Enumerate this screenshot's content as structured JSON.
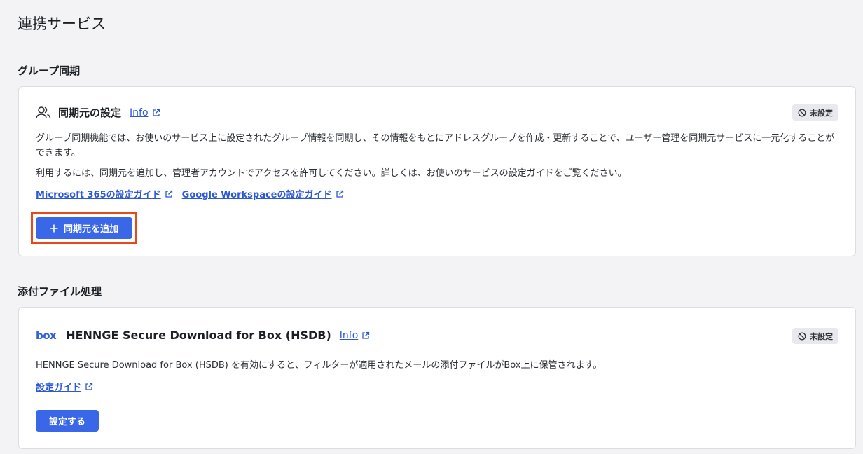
{
  "page": {
    "title": "連携サービス"
  },
  "group_sync": {
    "section_title": "グループ同期",
    "card_title": "同期元の設定",
    "info_label": "Info",
    "status_badge": "未設定",
    "description_1": "グループ同期機能では、お使いのサービス上に設定されたグループ情報を同期し、その情報をもとにアドレスグループを作成・更新することで、ユーザー管理を同期元サービスに一元化することができます。",
    "description_2": "利用するには、同期元を追加し、管理者アカウントでアクセスを許可してください。詳しくは、お使いのサービスの設定ガイドをご覧ください。",
    "guide_links": [
      "Microsoft 365の設定ガイド",
      "Google Workspaceの設定ガイド"
    ],
    "add_button": "同期元を追加"
  },
  "attachment": {
    "section_title": "添付ファイル処理",
    "box_logo": "box",
    "card_title": "HENNGE Secure Download for Box (HSDB)",
    "info_label": "Info",
    "status_badge": "未設定",
    "description": "HENNGE Secure Download for Box (HSDB) を有効にすると、フィルターが適用されたメールの添付ファイルがBox上に保管されます。",
    "guide_link": "設定ガイド",
    "setup_button": "設定する"
  },
  "colors": {
    "accent": "#3a66e8",
    "link": "#2b59d6",
    "highlight": "#e8481a",
    "badge_bg": "#e8e9ec"
  },
  "icons": [
    "users-icon",
    "external-link-icon",
    "prohibited-icon",
    "plus-icon",
    "box-logo-icon"
  ]
}
